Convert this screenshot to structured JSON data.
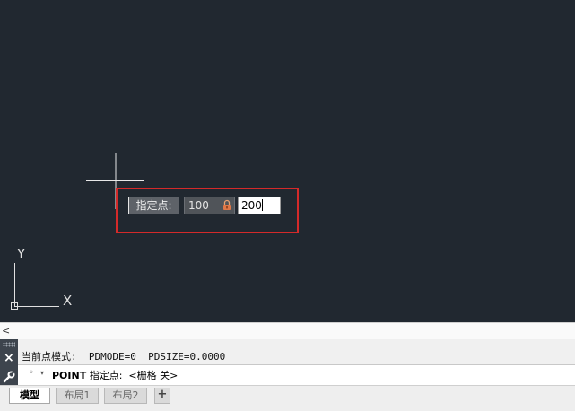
{
  "viewport": {
    "background_color": "#212830",
    "dynamic_input": {
      "prompt_label": "指定点:",
      "x_value": "100",
      "x_locked": true,
      "y_value": "200"
    },
    "highlight_color": "#d42a2a",
    "ucs": {
      "x_label": "X",
      "y_label": "Y"
    }
  },
  "scrollbar": {
    "left_arrow": "<"
  },
  "command_window": {
    "close_icon": "×",
    "history_line": "当前点模式:  PDMODE=0  PDSIZE=0.0000",
    "prompt": {
      "dot": "◦",
      "arrow": "▾",
      "command": "POINT",
      "text": " 指定点:  <栅格 关>"
    }
  },
  "layout_tabs": {
    "tabs": [
      {
        "label": "模型",
        "active": true
      },
      {
        "label": "布局1",
        "active": false
      },
      {
        "label": "布局2",
        "active": false
      }
    ],
    "add_label": "+"
  }
}
